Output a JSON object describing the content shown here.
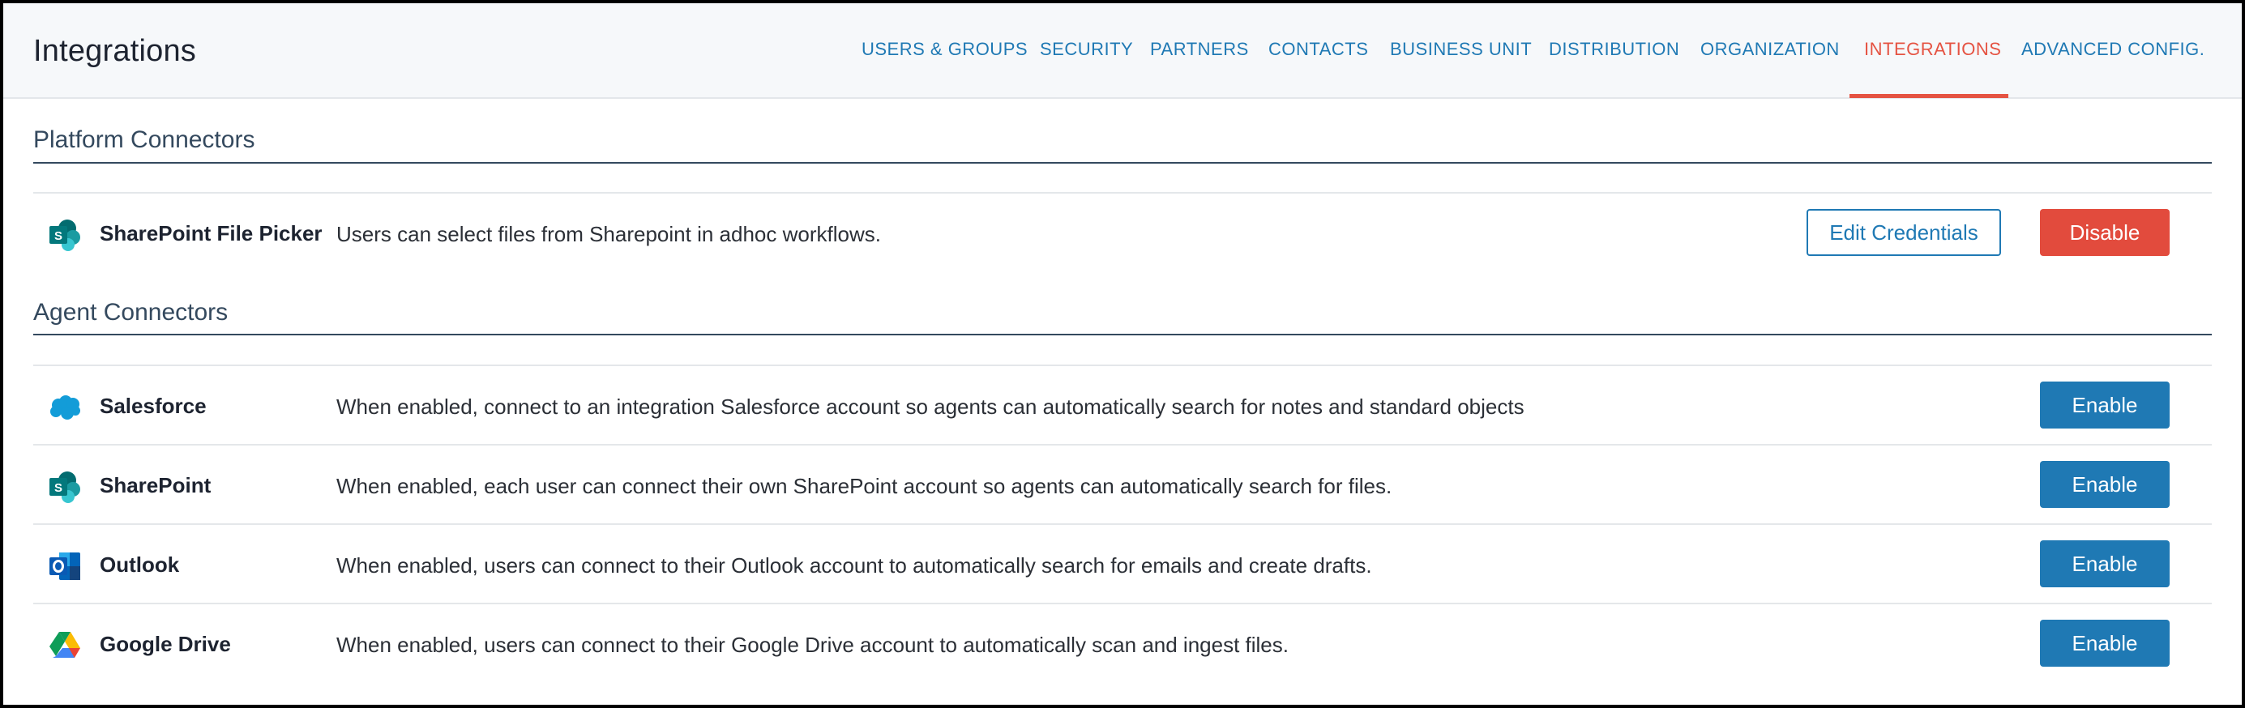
{
  "header": {
    "title": "Integrations",
    "tabs": [
      {
        "label": "USERS & GROUPS",
        "active": false
      },
      {
        "label": "SECURITY",
        "active": false
      },
      {
        "label": "PARTNERS",
        "active": false
      },
      {
        "label": "CONTACTS",
        "active": false
      },
      {
        "label": "BUSINESS UNIT",
        "active": false
      },
      {
        "label": "DISTRIBUTION",
        "active": false
      },
      {
        "label": "ORGANIZATION",
        "active": false
      },
      {
        "label": "INTEGRATIONS",
        "active": true
      },
      {
        "label": "ADVANCED CONFIG.",
        "active": false
      }
    ]
  },
  "platform": {
    "title": "Platform Connectors",
    "items": [
      {
        "icon": "sharepoint-icon",
        "name": "SharePoint File Picker",
        "description": "Users can select files from Sharepoint in adhoc workflows.",
        "secondary_action": "Edit Credentials",
        "action": "Disable"
      }
    ]
  },
  "agent": {
    "title": "Agent Connectors",
    "items": [
      {
        "icon": "salesforce-icon",
        "name": "Salesforce",
        "description": "When enabled, connect to an integration Salesforce account so agents can automatically search for notes and standard objects",
        "action": "Enable"
      },
      {
        "icon": "sharepoint-icon",
        "name": "SharePoint",
        "description": "When enabled, each user can connect their own SharePoint account so agents can automatically search for files.",
        "action": "Enable"
      },
      {
        "icon": "outlook-icon",
        "name": "Outlook",
        "description": "When enabled, users can connect to their Outlook account to automatically search for emails and create drafts.",
        "action": "Enable"
      },
      {
        "icon": "google-drive-icon",
        "name": "Google Drive",
        "description": "When enabled, users can connect to their Google Drive account to automatically scan and ingest files.",
        "action": "Enable"
      }
    ]
  },
  "colors": {
    "accent": "#1f79b4",
    "active_tab": "#e55342",
    "danger": "#e24b3d",
    "section_heading": "#34495e"
  }
}
